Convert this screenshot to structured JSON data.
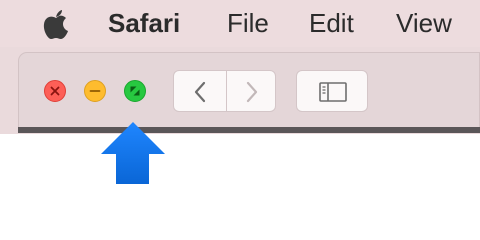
{
  "menubar": {
    "app_name": "Safari",
    "items": [
      "File",
      "Edit",
      "View"
    ]
  },
  "icons": {
    "apple": "apple-logo-icon",
    "close": "close-icon",
    "minimize": "minimize-icon",
    "zoom": "fullscreen-icon",
    "back": "chevron-left-icon",
    "forward": "chevron-right-icon",
    "sidebar": "sidebar-icon",
    "pointer": "arrow-up-icon"
  },
  "colors": {
    "menubar_bg": "#eddcde",
    "close": "#fd5f57",
    "minimize": "#febc2e",
    "zoom": "#27c840",
    "arrow": "#1a7cf2"
  }
}
